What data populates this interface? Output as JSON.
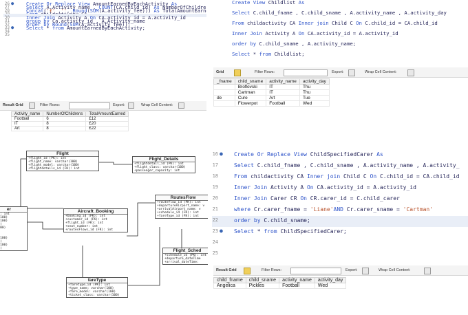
{
  "panel1": {
    "code": [
      {
        "ln": "26",
        "dot": true,
        "segs": [
          [
            "kw",
            "Create Or Replace View "
          ],
          [
            "txt",
            "AmountEarnedByEachActivity "
          ],
          [
            "kw",
            "As"
          ]
        ]
      },
      {
        "ln": "27",
        "dot": false,
        "segs": [
          [
            "kw",
            "Select "
          ],
          [
            "txt",
            "A.Activity_name , "
          ],
          [
            "fn",
            "COUNT"
          ],
          [
            "txt",
            "(CA.child_id) "
          ],
          [
            "kw",
            "As "
          ],
          [
            "txt",
            "NumberOfChildrens,"
          ]
        ]
      },
      {
        "ln": "28",
        "dot": false,
        "segs": [
          [
            "fn",
            "Concat"
          ],
          [
            "txt",
            "("
          ],
          [
            "str",
            "'£'"
          ],
          [
            "txt",
            " ,"
          ],
          [
            "str",
            "''"
          ],
          [
            "txt",
            ", "
          ],
          [
            "fn",
            "Round"
          ],
          [
            "txt",
            "("
          ],
          [
            "fn",
            "SUM"
          ],
          [
            "txt",
            "(A.activity_fee))) "
          ],
          [
            "kw",
            "As "
          ],
          [
            "txt",
            "TotalAmountEarned"
          ]
        ]
      },
      {
        "ln": "29",
        "dot": false,
        "segs": [
          [
            "kw",
            "From "
          ],
          [
            "txt",
            "childactivity CA"
          ]
        ]
      },
      {
        "ln": "30",
        "dot": false,
        "hl": true,
        "segs": [
          [
            "kw",
            "Inner Join "
          ],
          [
            "txt",
            "Activity A "
          ],
          [
            "kw",
            "On "
          ],
          [
            "txt",
            "CA.activity_id = A.activity_id"
          ]
        ]
      },
      {
        "ln": "31",
        "dot": false,
        "segs": [
          [
            "kw",
            "group by "
          ],
          [
            "txt",
            "Ca.activity_id , A.Activity_name"
          ]
        ]
      },
      {
        "ln": "32",
        "dot": false,
        "segs": [
          [
            "kw",
            "order by "
          ],
          [
            "fn",
            "Round"
          ],
          [
            "txt",
            "("
          ],
          [
            "fn",
            "SUM"
          ],
          [
            "txt",
            "(A.activity_fee));"
          ]
        ]
      },
      {
        "ln": "33",
        "dot": true,
        "segs": [
          [
            "kw",
            "Select "
          ],
          [
            "txt",
            "* "
          ],
          [
            "kw",
            "from "
          ],
          [
            "txt",
            "AmountEarnedByEachActivity;"
          ]
        ]
      },
      {
        "ln": "34",
        "dot": false,
        "segs": []
      },
      {
        "ln": "35",
        "dot": false,
        "segs": []
      }
    ],
    "toolbar": {
      "result_grid": "Result Grid",
      "filter_rows": "Filter Rows:",
      "export": "Export:",
      "wrap": "Wrap Cell Content:"
    },
    "table": {
      "headers": [
        "Activity_name",
        "NumberOfChildrens",
        "TotalAmountEarned"
      ],
      "rows": [
        [
          "Football",
          "6",
          "£12"
        ],
        [
          "IT",
          "8",
          "£20"
        ],
        [
          "Art",
          "8",
          "£22"
        ]
      ]
    }
  },
  "panel2": {
    "code": [
      {
        "segs": [
          [
            "kw",
            "Create View "
          ],
          [
            "txt",
            "Childlist "
          ],
          [
            "kw",
            "As"
          ]
        ]
      },
      {
        "segs": [
          [
            "kw",
            "Select "
          ],
          [
            "txt",
            "C.child_fname , C.child_sname , A.activity_name , A.activity_day"
          ]
        ]
      },
      {
        "segs": [
          [
            "kw",
            "From "
          ],
          [
            "txt",
            "childactivity CA "
          ],
          [
            "kw",
            "Inner join "
          ],
          [
            "txt",
            "Child C "
          ],
          [
            "kw",
            "On "
          ],
          [
            "txt",
            "C.child_id = CA.child_id"
          ]
        ]
      },
      {
        "segs": [
          [
            "kw",
            "Inner Join "
          ],
          [
            "txt",
            "Activity A "
          ],
          [
            "kw",
            "On "
          ],
          [
            "txt",
            "CA.activity_id = A.activity_id"
          ]
        ]
      },
      {
        "segs": [
          [
            "kw",
            "order by "
          ],
          [
            "txt",
            "C.child_sname , A.activity_name;"
          ]
        ]
      },
      {
        "segs": [
          [
            "kw",
            "Select "
          ],
          [
            "txt",
            "* "
          ],
          [
            "kw",
            "from "
          ],
          [
            "txt",
            "Childlist;"
          ]
        ]
      }
    ],
    "toolbar": {
      "result_grid": "Grid",
      "filter_rows": "Filter Rows:",
      "export": "Export:",
      "wrap": "Wrap Cell Content:"
    },
    "table": {
      "headers": [
        "_fname",
        "child_sname",
        "activity_name",
        "activity_day"
      ],
      "rows": [
        [
          "",
          "Broflovski",
          "IT",
          "Thu"
        ],
        [
          "",
          "Cartman",
          "IT",
          "Thu"
        ],
        [
          "de",
          "Cure",
          "Art",
          "Tue"
        ],
        [
          "",
          "Flowerpot",
          "Football",
          "Wed"
        ]
      ]
    }
  },
  "erd": {
    "tables": [
      {
        "title": "Flight",
        "fields": [
          "+flight_id (PK): int",
          "+flight_name: varchar(100)",
          "+flight_model: varchar(100)",
          "+flightdetails_id (FK): int"
        ]
      },
      {
        "title": "Flight_Details",
        "fields": [
          "+flightdetail_id (PK): int",
          "+flight_class: varchar(100)",
          "+passenger_capacity: int"
        ]
      },
      {
        "title": "Aircraft_Booking",
        "fields": [
          "+booking_id (PK): int",
          "+customer_id (FK): int",
          "+flight_id (FK): int",
          "+seat_number: int",
          "+routesFlows_id (FK): int"
        ]
      },
      {
        "title": "RoutesFlow",
        "fields": [
          "+routeflow_id (PK): int",
          "+departureAirport_name: v",
          "+arrivalAirport_name: v",
          "+schedule_id (FK): int",
          "+fareType_id (FK): int"
        ]
      },
      {
        "title": "Flight_Sched",
        "fields": [
          "+schedule_id (PK): int",
          "+departure_dateTime",
          "+arrival_dateTime:"
        ]
      },
      {
        "title": "fareType",
        "fields": [
          "+faretype_id (PK): int",
          "+type_name: varchar(100)",
          "+fare_model: varchar(100)",
          "+ticket_class: varchar(100)"
        ]
      },
      {
        "title": "er",
        "fields": [
          "(PK): int",
          "har(100)",
          "har(100)",
          "(100)",
          "ar(100)",
          "100)",
          "100)",
          "har(100)",
          "(100)",
          "har(100)",
          "(100)"
        ]
      }
    ]
  },
  "panel3": {
    "code": [
      {
        "ln": "16",
        "dot": true,
        "segs": [
          [
            "kw",
            "Create Or Replace View "
          ],
          [
            "txt",
            "ChildSpecifiedCarer "
          ],
          [
            "kw",
            "As"
          ]
        ]
      },
      {
        "ln": "17",
        "dot": false,
        "segs": [
          [
            "kw",
            "Select "
          ],
          [
            "txt",
            "C.child_fname , C.child_sname , A.activity_name , A.activity_"
          ]
        ]
      },
      {
        "ln": "18",
        "dot": false,
        "segs": [
          [
            "kw",
            "From "
          ],
          [
            "txt",
            "childactivity CA "
          ],
          [
            "kw",
            "Inner join "
          ],
          [
            "txt",
            "Child C "
          ],
          [
            "kw",
            "On "
          ],
          [
            "txt",
            "C.child_id = CA.child_id"
          ]
        ]
      },
      {
        "ln": "19",
        "dot": false,
        "segs": [
          [
            "kw",
            "Inner Join "
          ],
          [
            "txt",
            "Activity A "
          ],
          [
            "kw",
            "On "
          ],
          [
            "txt",
            "CA.activity_id = A.activity_id"
          ]
        ]
      },
      {
        "ln": "20",
        "dot": false,
        "segs": [
          [
            "kw",
            "Inner Join "
          ],
          [
            "txt",
            "Carer CR "
          ],
          [
            "kw",
            "On "
          ],
          [
            "txt",
            "CR.carer_id = C.child_carer"
          ]
        ]
      },
      {
        "ln": "21",
        "dot": false,
        "segs": [
          [
            "kw",
            "where "
          ],
          [
            "txt",
            "Cr.carer_fname = "
          ],
          [
            "str",
            "'Liane'"
          ],
          [
            "kw",
            "AND "
          ],
          [
            "txt",
            "Cr.carer_sname = "
          ],
          [
            "str",
            "'Cartman'"
          ]
        ]
      },
      {
        "ln": "22",
        "dot": false,
        "hl": true,
        "segs": [
          [
            "kw",
            "order by "
          ],
          [
            "txt",
            "C.child_sname;"
          ]
        ]
      },
      {
        "ln": "23",
        "dot": true,
        "segs": [
          [
            "kw",
            "Select "
          ],
          [
            "txt",
            "* "
          ],
          [
            "kw",
            "from "
          ],
          [
            "txt",
            "ChildSpecifiedCarer;"
          ]
        ]
      },
      {
        "ln": "24",
        "dot": false,
        "segs": []
      },
      {
        "ln": "25",
        "dot": false,
        "segs": []
      }
    ],
    "toolbar": {
      "result_grid": "Result Grid",
      "filter_rows": "Filter Rows:",
      "export": "Export:",
      "wrap": "Wrap Cell Content:"
    },
    "table": {
      "headers": [
        "child_fname",
        "child_sname",
        "activity_name",
        "activity_day"
      ],
      "rows": [
        [
          "Angelica",
          "Pickles",
          "Football",
          "Wed"
        ]
      ]
    }
  }
}
